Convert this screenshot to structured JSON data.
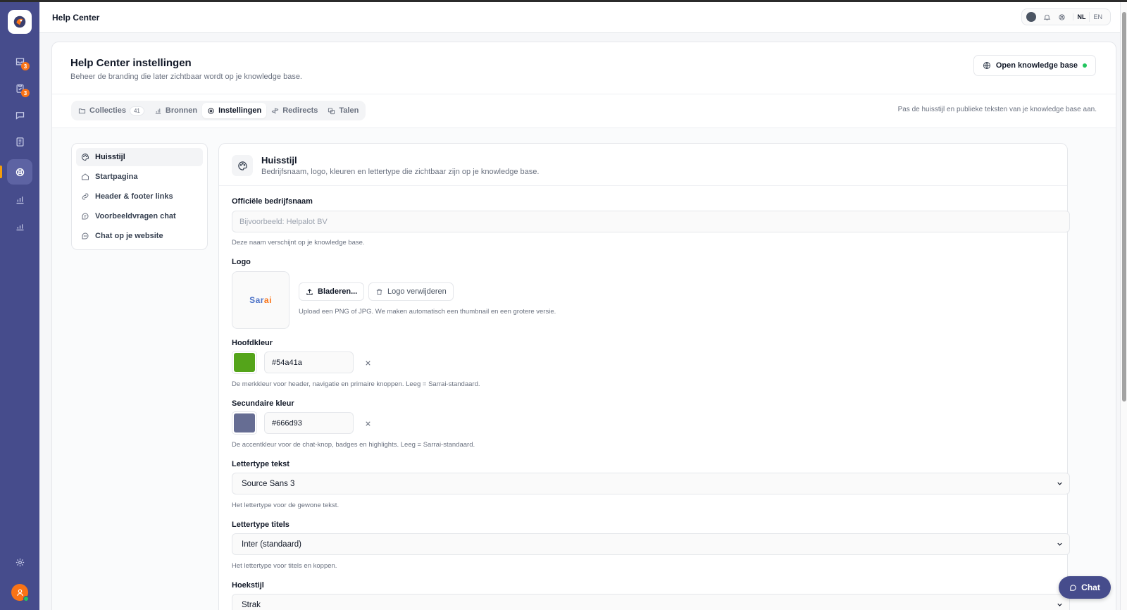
{
  "app": {
    "title": "Help Center"
  },
  "rail": {
    "badges": {
      "inbox": "3",
      "tasks": "3"
    }
  },
  "topbar": {
    "languages": [
      {
        "code": "NL",
        "selected": true
      },
      {
        "code": "EN",
        "selected": false
      }
    ]
  },
  "page": {
    "title": "Help Center instellingen",
    "subtitle": "Beheer de branding die later zichtbaar wordt op je knowledge base.",
    "open_kb_label": "Open knowledge base",
    "tabs_hint": "Pas de huisstijl en publieke teksten van je knowledge base aan."
  },
  "tabs": [
    {
      "label": "Collecties",
      "count": "41",
      "icon": "folder-icon",
      "active": false
    },
    {
      "label": "Bronnen",
      "icon": "bar-chart-icon",
      "active": false
    },
    {
      "label": "Instellingen",
      "icon": "gear-icon",
      "active": true
    },
    {
      "label": "Redirects",
      "icon": "signpost-icon",
      "active": false
    },
    {
      "label": "Talen",
      "icon": "translate-icon",
      "active": false
    }
  ],
  "subnav": [
    {
      "label": "Huisstijl",
      "icon": "palette-icon",
      "active": true
    },
    {
      "label": "Startpagina",
      "icon": "home-icon",
      "active": false
    },
    {
      "label": "Header & footer links",
      "icon": "link-icon",
      "active": false
    },
    {
      "label": "Voorbeeldvragen chat",
      "icon": "chat-question-icon",
      "active": false
    },
    {
      "label": "Chat op je website",
      "icon": "chat-bubble-icon",
      "active": false
    }
  ],
  "panel": {
    "title": "Huisstijl",
    "description": "Bedrijfsnaam, logo, kleuren en lettertype die zichtbaar zijn op je knowledge base."
  },
  "form": {
    "company_name": {
      "label": "Officiële bedrijfsnaam",
      "value": "",
      "placeholder": "Bijvoorbeeld: Helpalot BV",
      "help": "Deze naam verschijnt op je knowledge base."
    },
    "logo": {
      "label": "Logo",
      "preview_part1": "Sar",
      "preview_part2": "ai",
      "browse_label": "Bladeren...",
      "remove_label": "Logo verwijderen",
      "help": "Upload een PNG of JPG. We maken automatisch een thumbnail en een grotere versie."
    },
    "primary_color": {
      "label": "Hoofdkleur",
      "value": "#54a41a",
      "help": "De merkkleur voor header, navigatie en primaire knoppen. Leeg = Sarrai-standaard."
    },
    "secondary_color": {
      "label": "Secundaire kleur",
      "value": "#666d93",
      "help": "De accentkleur voor de chat-knop, badges en highlights. Leeg = Sarrai-standaard."
    },
    "font_text": {
      "label": "Lettertype tekst",
      "value": "Source Sans 3",
      "help": "Het lettertype voor de gewone tekst."
    },
    "font_titles": {
      "label": "Lettertype titels",
      "value": "Inter (standaard)",
      "help": "Het lettertype voor titels en koppen."
    },
    "corner_style": {
      "label": "Hoekstijl",
      "value": "Strak"
    }
  },
  "chat_widget": {
    "label": "Chat"
  },
  "colors": {
    "rail": "#464c8c",
    "accent": "#f97316",
    "online": "#22c55e"
  }
}
